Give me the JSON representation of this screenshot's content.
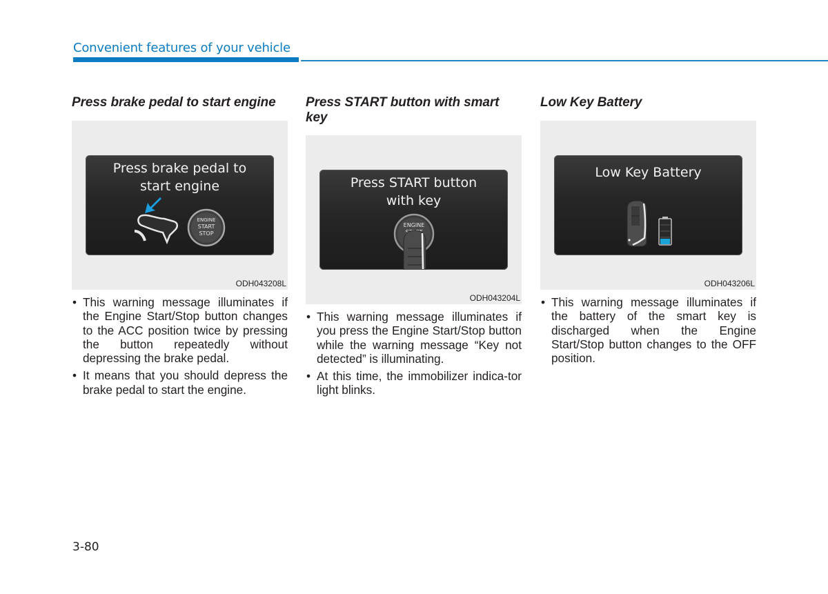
{
  "header": {
    "section_title": "Convenient features of your vehicle",
    "accent_color": "#0b7cc1"
  },
  "columns": [
    {
      "title": "Press brake pedal to start engine",
      "figure": {
        "screen_text_line1": "Press brake pedal to",
        "screen_text_line2": "start engine",
        "button_label_1": "ENGINE",
        "button_label_2": "START",
        "button_label_3": "STOP",
        "icons": [
          "blue-arrow-icon",
          "brake-pedal-foot-icon",
          "engine-start-stop-button-icon"
        ],
        "code": "ODH043208L"
      },
      "bullets": [
        "This warning message illuminates if the Engine Start/Stop button changes to the ACC position twice by pressing the button repeatedly without depressing the brake pedal.",
        "It means that you should depress the brake pedal to start the engine."
      ]
    },
    {
      "title": "Press START button with smart key",
      "figure": {
        "screen_text_line1": "Press START button",
        "screen_text_line2": "with key",
        "button_label_1": "ENGINE",
        "button_label_2": "START",
        "icons": [
          "engine-start-button-icon",
          "smart-key-icon"
        ],
        "code": "ODH043204L"
      },
      "bullets": [
        "This warning message illuminates if you press the Engine Start/Stop button while the warning message “Key not detected” is illuminating.",
        "At this time, the immobilizer indica-tor light blinks."
      ]
    },
    {
      "title": "Low Key Battery",
      "figure": {
        "screen_text_line1": "Low Key Battery",
        "icons": [
          "smart-key-icon",
          "battery-low-icon"
        ],
        "battery_level_fraction": 0.25,
        "battery_color": "#1aa3d9",
        "code": "ODH043206L"
      },
      "bullets": [
        "This warning message illuminates if the battery of the smart key is discharged when the Engine Start/Stop button changes to the OFF position."
      ]
    }
  ],
  "bullet_glyph": "•",
  "footer": {
    "page_number": "3-80"
  }
}
